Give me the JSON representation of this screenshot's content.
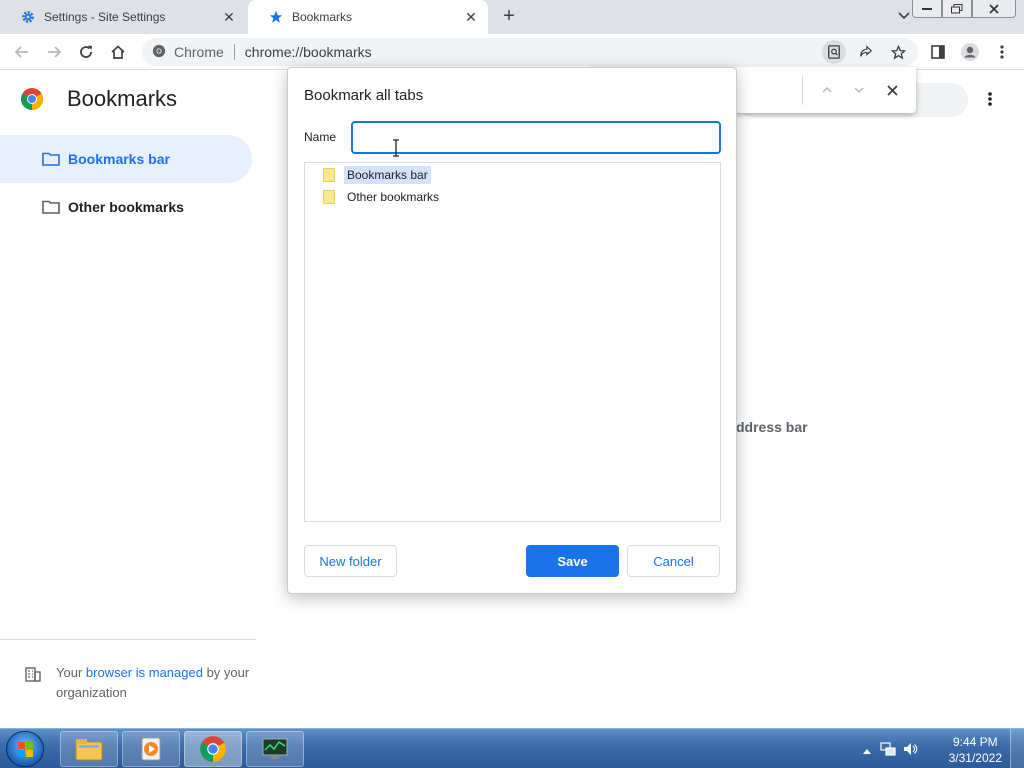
{
  "tabs": [
    {
      "title": "Settings - Site Settings",
      "icon": "gear-icon",
      "active": false
    },
    {
      "title": "Bookmarks",
      "icon": "star-icon",
      "active": true
    }
  ],
  "omnibox": {
    "site_label": "Chrome",
    "url": "chrome://bookmarks"
  },
  "page": {
    "title": "Bookmarks",
    "sidebar": [
      {
        "label": "Bookmarks bar",
        "selected": true
      },
      {
        "label": "Other bookmarks",
        "selected": false
      }
    ],
    "managed": {
      "prefix": "Your ",
      "link": "browser is managed",
      "suffix": " by your organization"
    },
    "empty_partial": "ddress bar"
  },
  "dialog": {
    "title": "Bookmark all tabs",
    "name_label": "Name",
    "name_value": "",
    "folders": [
      {
        "label": "Bookmarks bar",
        "selected": true
      },
      {
        "label": "Other bookmarks",
        "selected": false
      }
    ],
    "new_folder_label": "New folder",
    "save_label": "Save",
    "cancel_label": "Cancel"
  },
  "taskbar": {
    "time": "9:44 PM",
    "date": "3/31/2022"
  },
  "colors": {
    "accent": "#1a73e8",
    "selected_bg": "#e8f0fe"
  }
}
